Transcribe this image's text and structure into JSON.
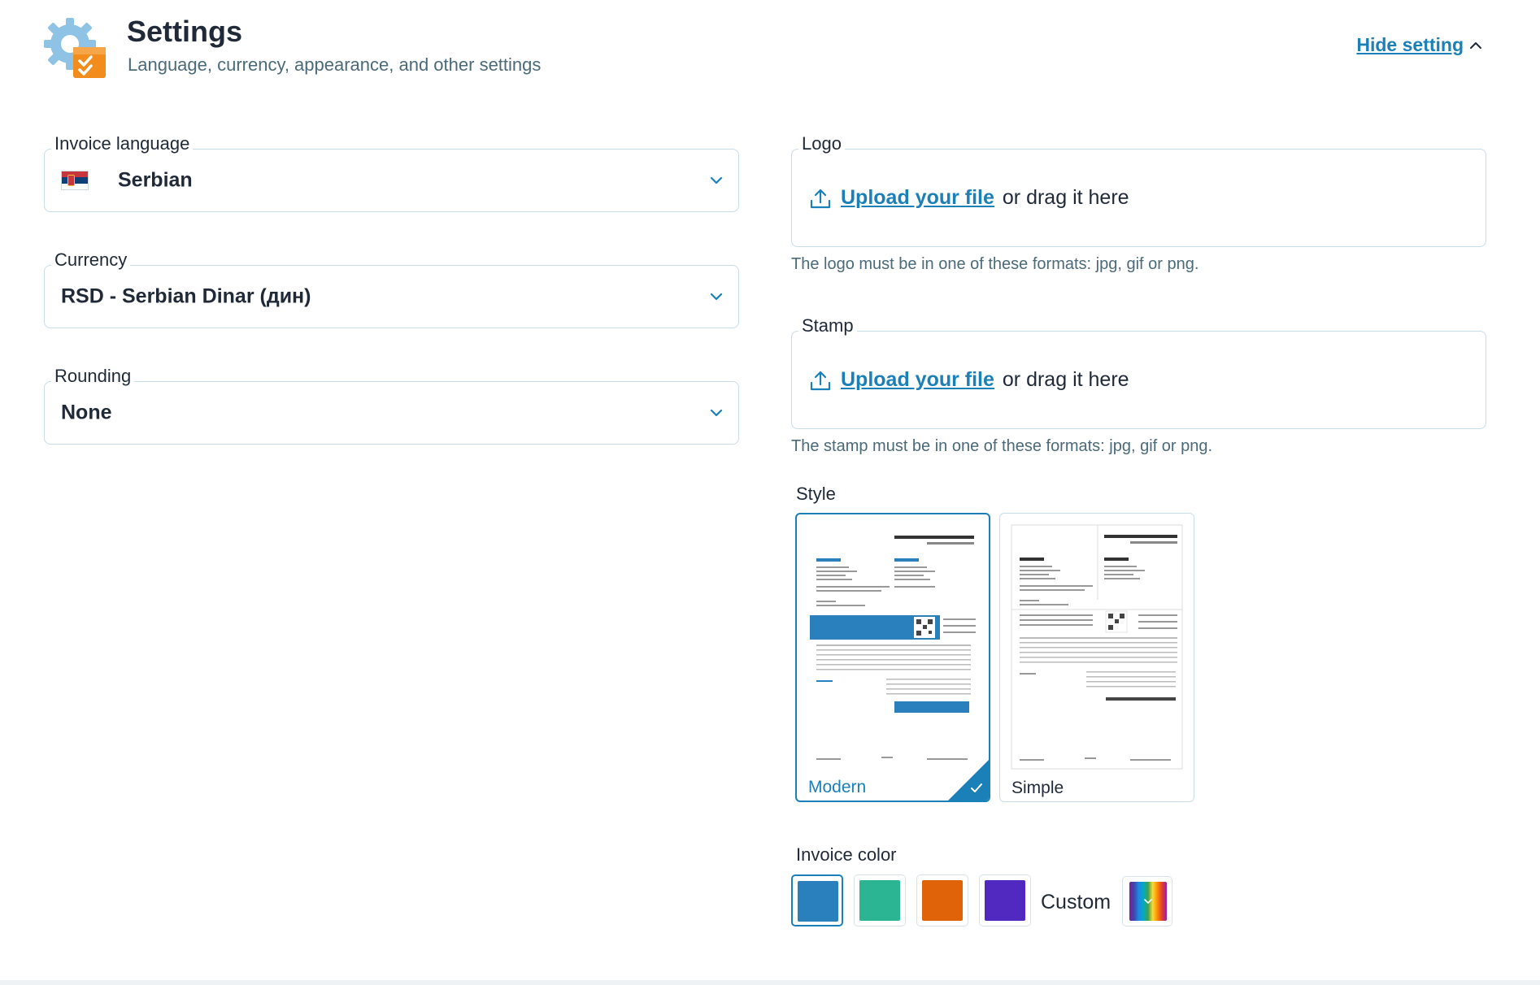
{
  "header": {
    "title": "Settings",
    "subtitle": "Language, currency, appearance, and other settings",
    "hide_label": "Hide setting"
  },
  "invoice_language": {
    "label": "Invoice language",
    "value": "Serbian",
    "flag_icon": "serbia-flag-icon"
  },
  "currency": {
    "label": "Currency",
    "value": "RSD - Serbian Dinar (дин)"
  },
  "rounding": {
    "label": "Rounding",
    "value": "None"
  },
  "logo": {
    "label": "Logo",
    "upload_link": "Upload your file",
    "upload_rest": "or drag it here",
    "hint": "The logo must be in one of these formats: jpg, gif or png."
  },
  "stamp": {
    "label": "Stamp",
    "upload_link": "Upload your file",
    "upload_rest": "or drag it here",
    "hint": "The stamp must be in one of these formats: jpg, gif or png."
  },
  "style": {
    "label": "Style",
    "options": [
      {
        "name": "Modern",
        "selected": true
      },
      {
        "name": "Simple",
        "selected": false
      }
    ]
  },
  "invoice_color": {
    "label": "Invoice color",
    "colors": [
      "#2a7fbd",
      "#2bb592",
      "#e0630a",
      "#5129c1"
    ],
    "selected_index": 0,
    "custom_label": "Custom"
  },
  "colors": {
    "accent": "#1b7fb8",
    "border": "#c9dde8",
    "muted_text": "#4b6a7a"
  }
}
